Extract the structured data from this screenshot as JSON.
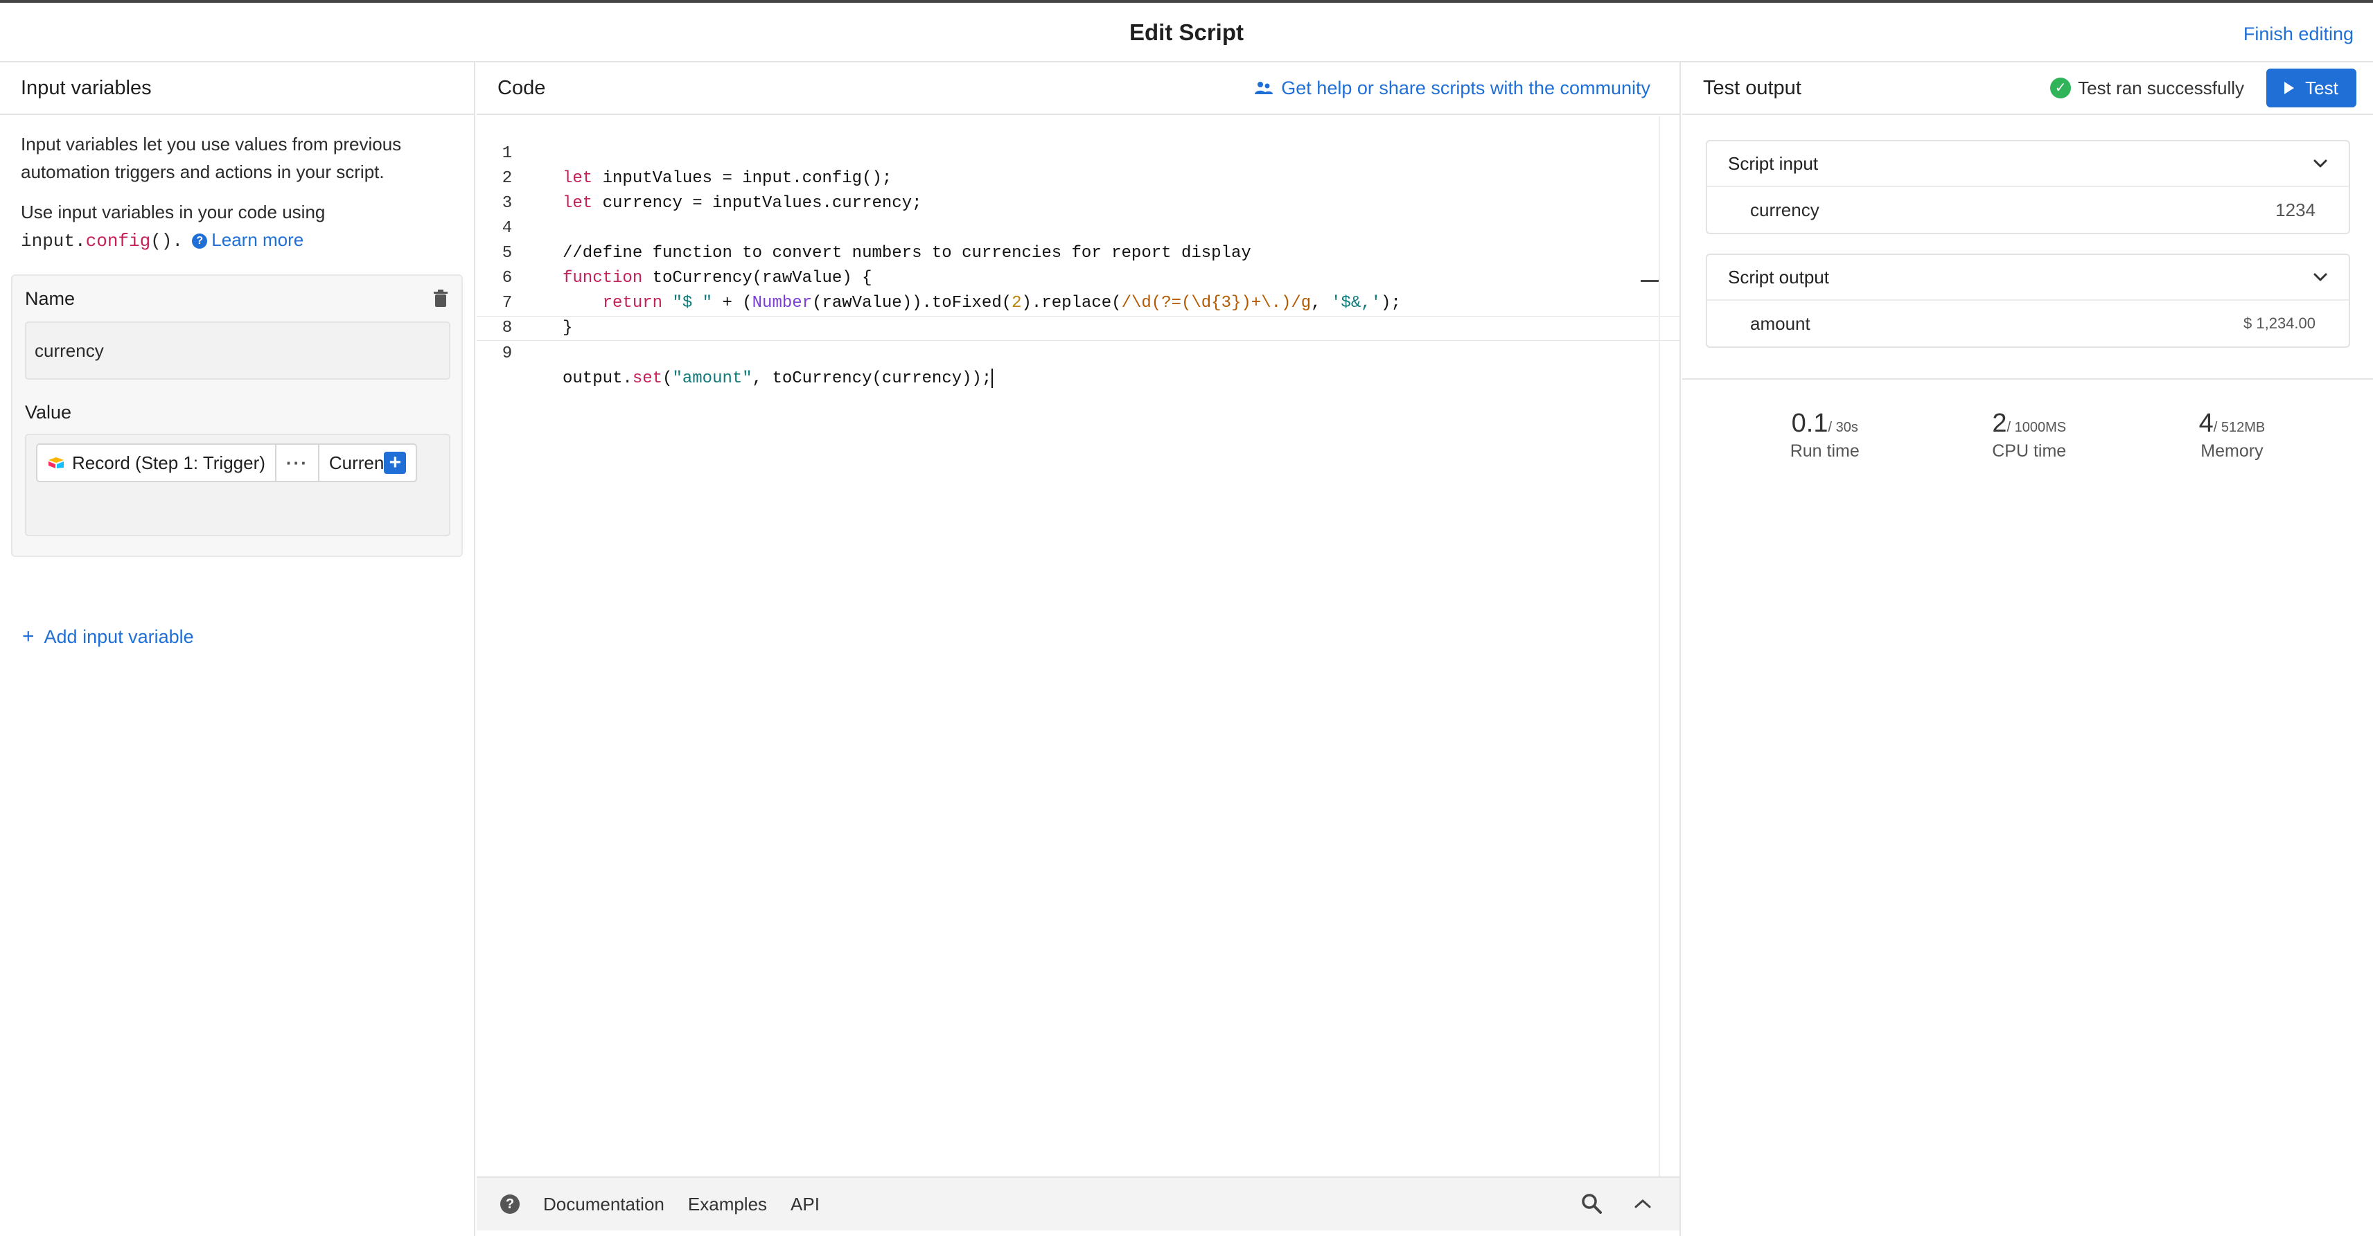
{
  "header": {
    "title": "Edit Script",
    "finish_label": "Finish editing"
  },
  "left": {
    "title": "Input variables",
    "description": "Input variables let you use values from previous automation triggers and actions in your script.",
    "usage_prefix": "Use input variables in your code using",
    "usage_code_obj": "input.",
    "usage_code_fn": "config",
    "usage_code_tail": "().",
    "learn_more": "Learn more",
    "variable": {
      "name_label": "Name",
      "name_value": "currency",
      "value_label": "Value",
      "token_record": "Record (Step 1: Trigger)",
      "token_more": "···",
      "token_field": "Curren"
    },
    "add_variable": "Add input variable"
  },
  "code": {
    "title": "Code",
    "community_link": "Get help or share scripts with the community",
    "line_numbers": [
      "1",
      "2",
      "3",
      "4",
      "5",
      "6",
      "7",
      "8",
      "9"
    ],
    "footer": {
      "documentation": "Documentation",
      "examples": "Examples",
      "api": "API"
    }
  },
  "test": {
    "title": "Test output",
    "status": "Test ran successfully",
    "button": "Test",
    "script_input": {
      "title": "Script input",
      "key": "currency",
      "value": "1234"
    },
    "script_output": {
      "title": "Script output",
      "key": "amount",
      "value": "$ 1,234.00"
    },
    "stats": [
      {
        "value": "0.1",
        "limit": "/ 30s",
        "label": "Run time"
      },
      {
        "value": "2",
        "limit": "/ 1000MS",
        "label": "CPU time"
      },
      {
        "value": "4",
        "limit": "/ 512MB",
        "label": "Memory"
      }
    ]
  },
  "colors": {
    "accent": "#1f6fd6",
    "success": "#2fb45a",
    "keyword": "#c4205a"
  }
}
